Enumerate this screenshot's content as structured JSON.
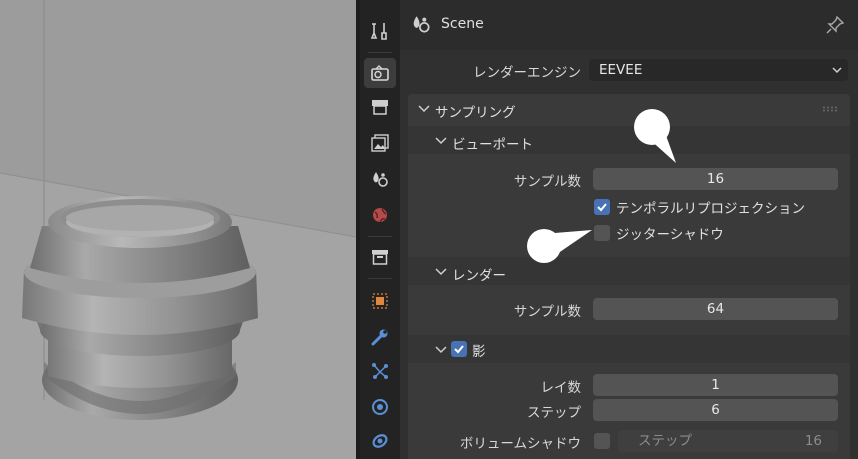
{
  "header": {
    "title": "Scene"
  },
  "render_engine": {
    "label": "レンダーエンジン",
    "value": "EEVEE"
  },
  "sampling": {
    "title": "サンプリング",
    "viewport": {
      "title": "ビューポート",
      "samples_label": "サンプル数",
      "samples_value": "16",
      "temporal_reprojection": {
        "label": "テンポラルリプロジェクション",
        "checked": true
      },
      "jitter_shadows": {
        "label": "ジッターシャドウ",
        "checked": false
      }
    },
    "render": {
      "title": "レンダー",
      "samples_label": "サンプル数",
      "samples_value": "64"
    },
    "shadows": {
      "title": "影",
      "checked": true,
      "rays_label": "レイ数",
      "rays_value": "1",
      "steps_label": "ステップ",
      "steps_value": "6",
      "volume_shadows_label": "ボリュームシャドウ",
      "volume_steps_label": "ステップ",
      "volume_steps_value": "16"
    }
  },
  "tabs": [
    "tool-icon",
    "render-icon",
    "output-icon",
    "view-layer-icon",
    "scene-icon",
    "world-icon",
    "collection-icon",
    "object-icon",
    "modifier-icon",
    "particles-icon",
    "physics-icon",
    "constraints-icon"
  ],
  "colors": {
    "accent": "#4772b3",
    "panel": "#3a3a3a",
    "field": "#545454"
  }
}
